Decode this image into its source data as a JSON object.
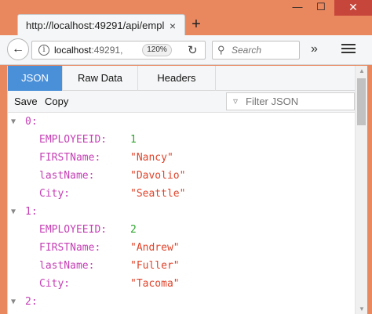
{
  "window": {
    "tab_title": "http://localhost:49291/api/empl",
    "tab_close": "×",
    "new_tab": "+",
    "minimize": "—",
    "maximize": "☐",
    "close": "✕"
  },
  "nav": {
    "back": "←",
    "info": "i",
    "url_host": "localhost",
    "url_rest": ":49291,",
    "zoom": "120%",
    "reload": "↻",
    "search_placeholder": "Search",
    "overflow": "»"
  },
  "viewer": {
    "tabs": [
      {
        "label": "JSON",
        "active": true
      },
      {
        "label": "Raw Data",
        "active": false
      },
      {
        "label": "Headers",
        "active": false
      }
    ],
    "save_label": "Save",
    "copy_label": "Copy",
    "filter_placeholder": "Filter JSON"
  },
  "json": {
    "items": [
      {
        "index": "0:",
        "fields": [
          {
            "key": "EMPLOYEEID:",
            "value": "1",
            "type": "number"
          },
          {
            "key": "FIRSTName:",
            "value": "\"Nancy\"",
            "type": "string"
          },
          {
            "key": "lastName:",
            "value": "\"Davolio\"",
            "type": "string"
          },
          {
            "key": "City:",
            "value": "\"Seattle\"",
            "type": "string"
          }
        ]
      },
      {
        "index": "1:",
        "fields": [
          {
            "key": "EMPLOYEEID:",
            "value": "2",
            "type": "number"
          },
          {
            "key": "FIRSTName:",
            "value": "\"Andrew\"",
            "type": "string"
          },
          {
            "key": "lastName:",
            "value": "\"Fuller\"",
            "type": "string"
          },
          {
            "key": "City:",
            "value": "\"Tacoma\"",
            "type": "string"
          }
        ]
      },
      {
        "index": "2:",
        "fields": []
      }
    ]
  },
  "colors": {
    "window_frame": "#e9875f",
    "active_tab": "#4a90d9",
    "json_key": "#c53fb5",
    "json_number": "#2ea52e",
    "json_string": "#e0442b"
  }
}
